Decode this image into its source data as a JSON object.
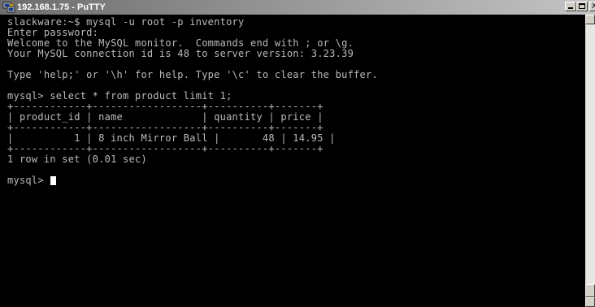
{
  "window": {
    "title": "192.168.1.75 - PuTTY",
    "icon": "putty-icon",
    "buttons": {
      "minimize_icon": "minimize-icon",
      "maximize_icon": "maximize-icon",
      "close_label": "X"
    }
  },
  "terminal": {
    "lines": [
      "slackware:~$ mysql -u root -p inventory",
      "Enter password:",
      "Welcome to the MySQL monitor.  Commands end with ; or \\g.",
      "Your MySQL connection id is 48 to server version: 3.23.39",
      "",
      "Type 'help;' or '\\h' for help. Type '\\c' to clear the buffer.",
      "",
      "mysql> select * from product limit 1;",
      "+------------+------------------+----------+-------+",
      "| product_id | name             | quantity | price |",
      "+------------+------------------+----------+-------+",
      "|          1 | 8 inch Mirror Ball |       48 | 14.95 |",
      "+------------+------------------+----------+-------+",
      "1 row in set (0.01 sec)",
      ""
    ],
    "prompt": "mysql> "
  },
  "colors": {
    "terminal_bg": "#000000",
    "terminal_fg": "#bbbbbb",
    "cursor": "#ffffff"
  }
}
